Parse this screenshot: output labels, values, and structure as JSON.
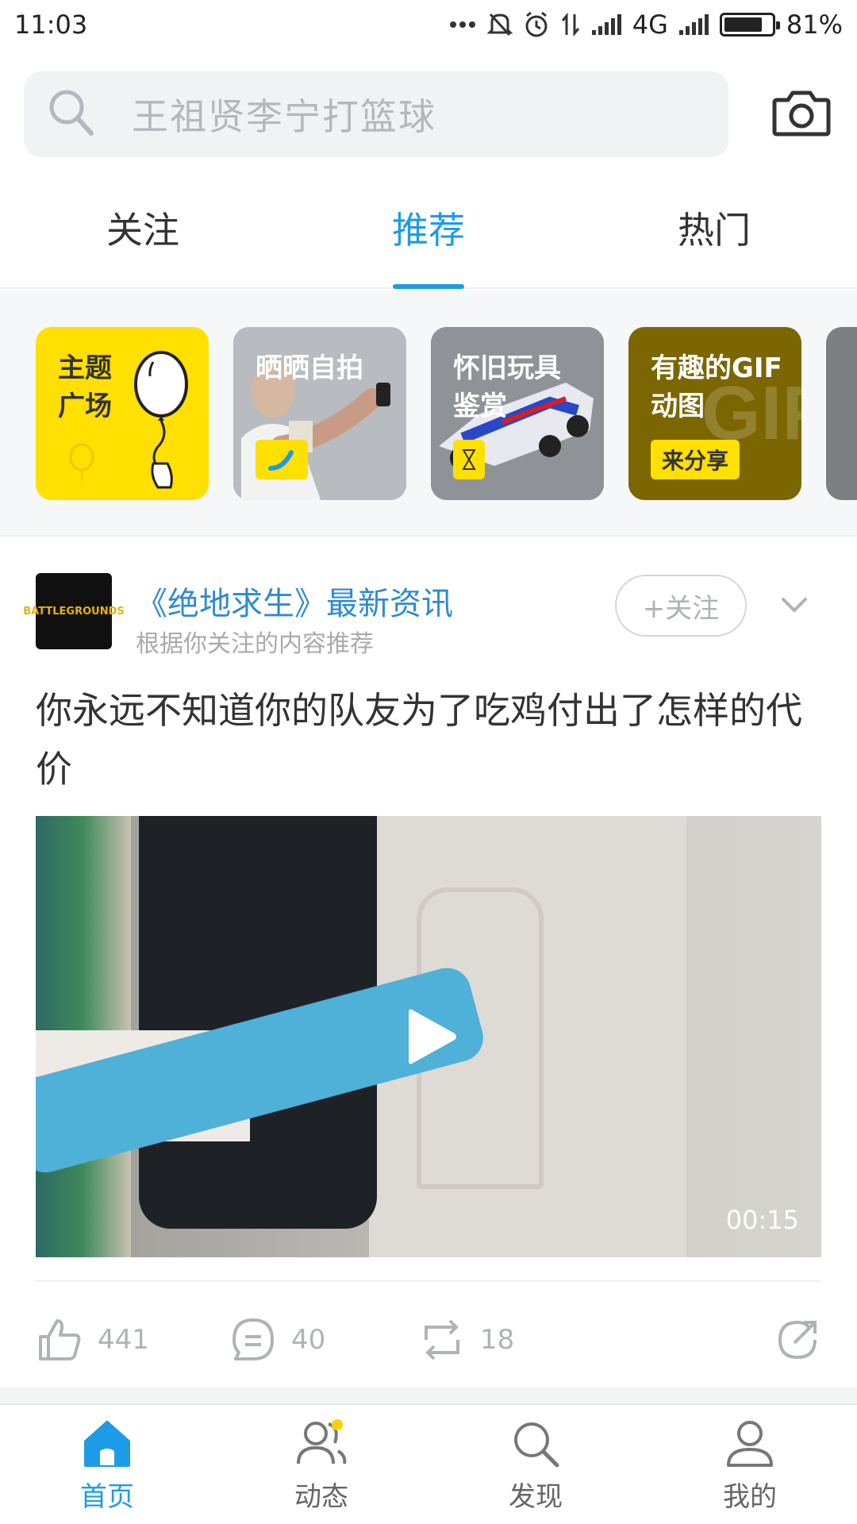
{
  "status_bar": {
    "time": "11:03",
    "network": "4G",
    "battery": "81%",
    "battery_level": 0.81
  },
  "search": {
    "placeholder": "王祖贤李宁打篮球"
  },
  "tabs": [
    {
      "label": "关注",
      "active": false
    },
    {
      "label": "推荐",
      "active": true
    },
    {
      "label": "热门",
      "active": false
    }
  ],
  "topics": [
    {
      "title_line1": "主题",
      "title_line2": "广场",
      "badge": ""
    },
    {
      "title_line1": "晒晒自拍",
      "title_line2": "",
      "badge": ""
    },
    {
      "title_line1": "怀旧玩具",
      "title_line2": "鉴赏",
      "badge": ""
    },
    {
      "title_line1": "有趣的GIF",
      "title_line2": "动图",
      "badge": "来分享"
    }
  ],
  "post": {
    "avatar_text": "BATTLEGROUNDS",
    "source_name": "《绝地求生》最新资讯",
    "source_sub": "根据你关注的内容推荐",
    "follow_label": "+关注",
    "title": "你永远不知道你的队友为了吃鸡付出了怎样的代价",
    "video_duration": "00:15",
    "likes": "441",
    "comments": "40",
    "reposts": "18"
  },
  "bottom_nav": [
    {
      "label": "首页",
      "icon": "home-icon",
      "active": true
    },
    {
      "label": "动态",
      "icon": "people-icon",
      "active": false
    },
    {
      "label": "发现",
      "icon": "search-icon",
      "active": false
    },
    {
      "label": "我的",
      "icon": "person-icon",
      "active": false
    }
  ],
  "colors": {
    "accent": "#1c9ce6",
    "topic_yellow": "#ffe000",
    "source_blue": "#2f8bd0"
  }
}
